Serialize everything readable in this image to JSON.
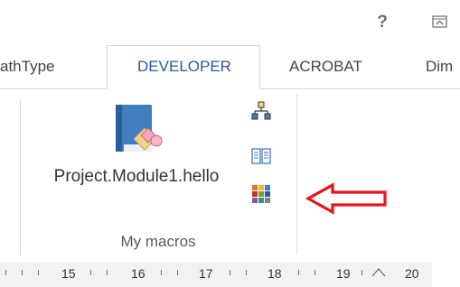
{
  "titlebar": {
    "help_icon": "?",
    "restore_icon": "restore-ribbon-icon"
  },
  "tabs": [
    {
      "label": "athType"
    },
    {
      "label": "DEVELOPER",
      "active": true
    },
    {
      "label": "ACROBAT"
    },
    {
      "label": "Dim"
    }
  ],
  "ribbon": {
    "macro_button_label": "Project.Module1.hello",
    "group_label": "My macros",
    "small_icons": [
      "org-chart-icon",
      "book-icon",
      "color-grid-icon"
    ]
  },
  "annotation": {
    "arrow_color": "#e8141b"
  },
  "ruler": {
    "numbers": [
      "15",
      "16",
      "17",
      "18",
      "19",
      "20"
    ]
  },
  "colors": {
    "active_tab_text": "#2b579a",
    "border": "#d4d4d4"
  }
}
